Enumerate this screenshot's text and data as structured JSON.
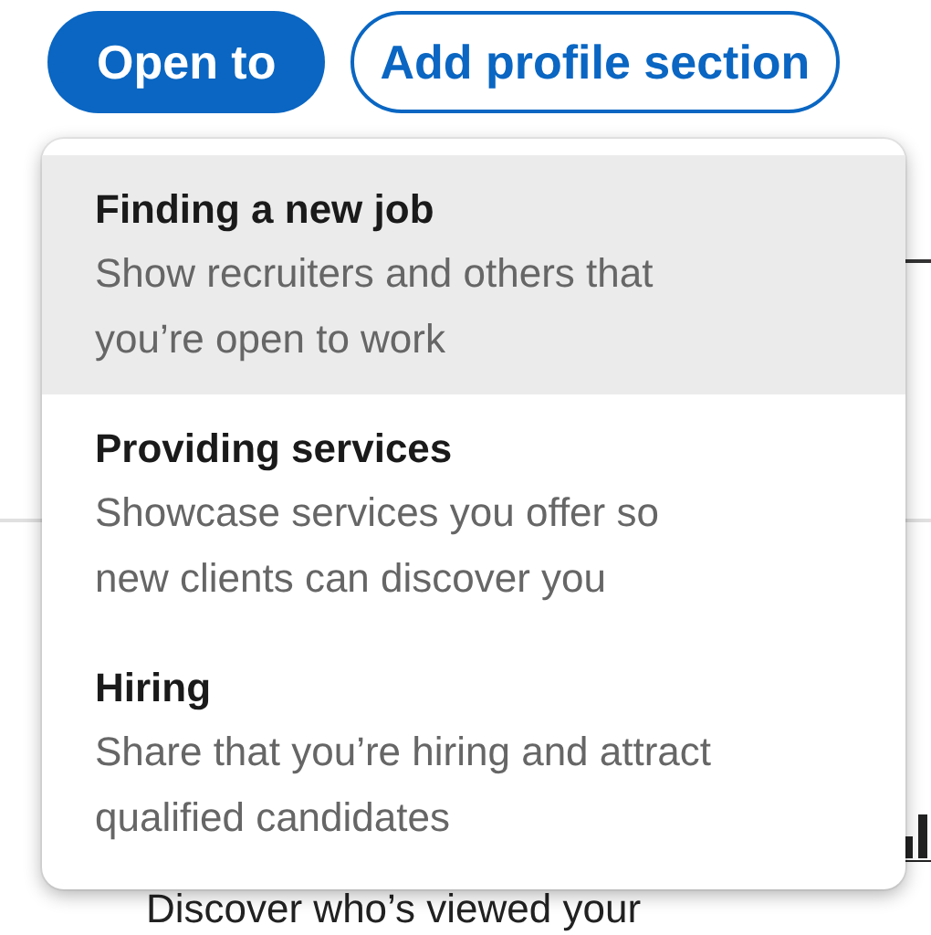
{
  "actions": [
    {
      "label": "Open to",
      "kind": "primary"
    },
    {
      "label": "Add profile section",
      "kind": "outline"
    }
  ],
  "menu": {
    "items": [
      {
        "title": "Finding a new job",
        "description": "Show recruiters and others that you’re open to work",
        "selected": true
      },
      {
        "title": "Providing services",
        "description": "Showcase services you offer so new clients can discover you",
        "selected": false
      },
      {
        "title": "Hiring",
        "description": "Share that you’re hiring and attract qualified candidates",
        "selected": false
      }
    ]
  },
  "background_text": "Discover who’s viewed your"
}
